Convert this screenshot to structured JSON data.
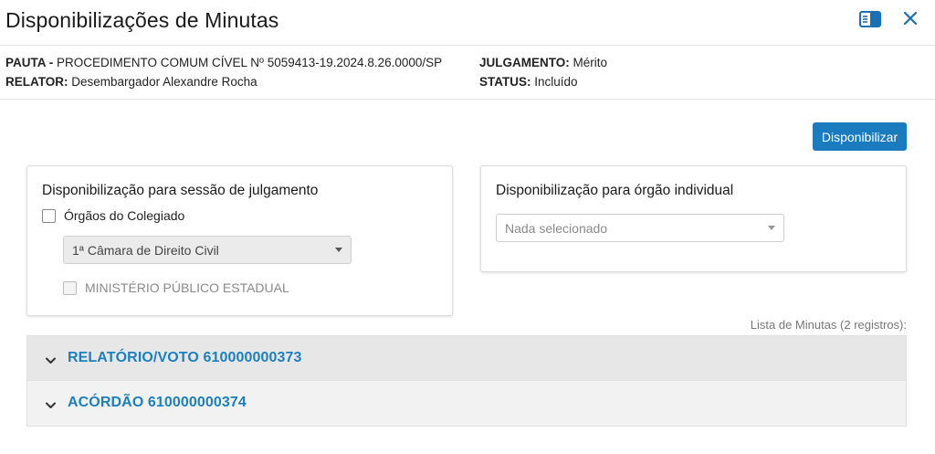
{
  "modal": {
    "title": "Disponibilizações de Minutas"
  },
  "info": {
    "pauta_label": "PAUTA -",
    "pauta_value": "PROCEDIMENTO COMUM CÍVEL Nº 5059413-19.2024.8.26.0000/SP",
    "relator_label": "RELATOR:",
    "relator_value": "Desembargador Alexandre Rocha",
    "julgamento_label": "JULGAMENTO:",
    "julgamento_value": "Mérito",
    "status_label": "STATUS:",
    "status_value": "Incluído"
  },
  "actions": {
    "disponibilizar_label": "Disponibilizar"
  },
  "sessao": {
    "title": "Disponibilização para sessão de julgamento",
    "orgaos_checkbox_label": "Órgãos do Colegiado",
    "orgaos_checked": false,
    "camara_select_value": "1ª Câmara de Direito Civil",
    "ministerio_checkbox_label": "MINISTÉRIO PÚBLICO ESTADUAL",
    "ministerio_checked": false
  },
  "individual": {
    "title": "Disponibilização para órgão individual",
    "select_placeholder": "Nada selecionado"
  },
  "lista": {
    "caption": "Lista de Minutas (2 registros):",
    "items": [
      {
        "label": "RELATÓRIO/VOTO 610000000373"
      },
      {
        "label": "ACÓRDÃO 610000000374"
      }
    ]
  },
  "colors": {
    "accent": "#1a7bbf",
    "link": "#1d7fc0"
  },
  "icons": {
    "panel": "sidebar-panel-icon",
    "close": "close-icon",
    "chevron": "chevron-down-icon",
    "caret": "caret-down-icon"
  }
}
